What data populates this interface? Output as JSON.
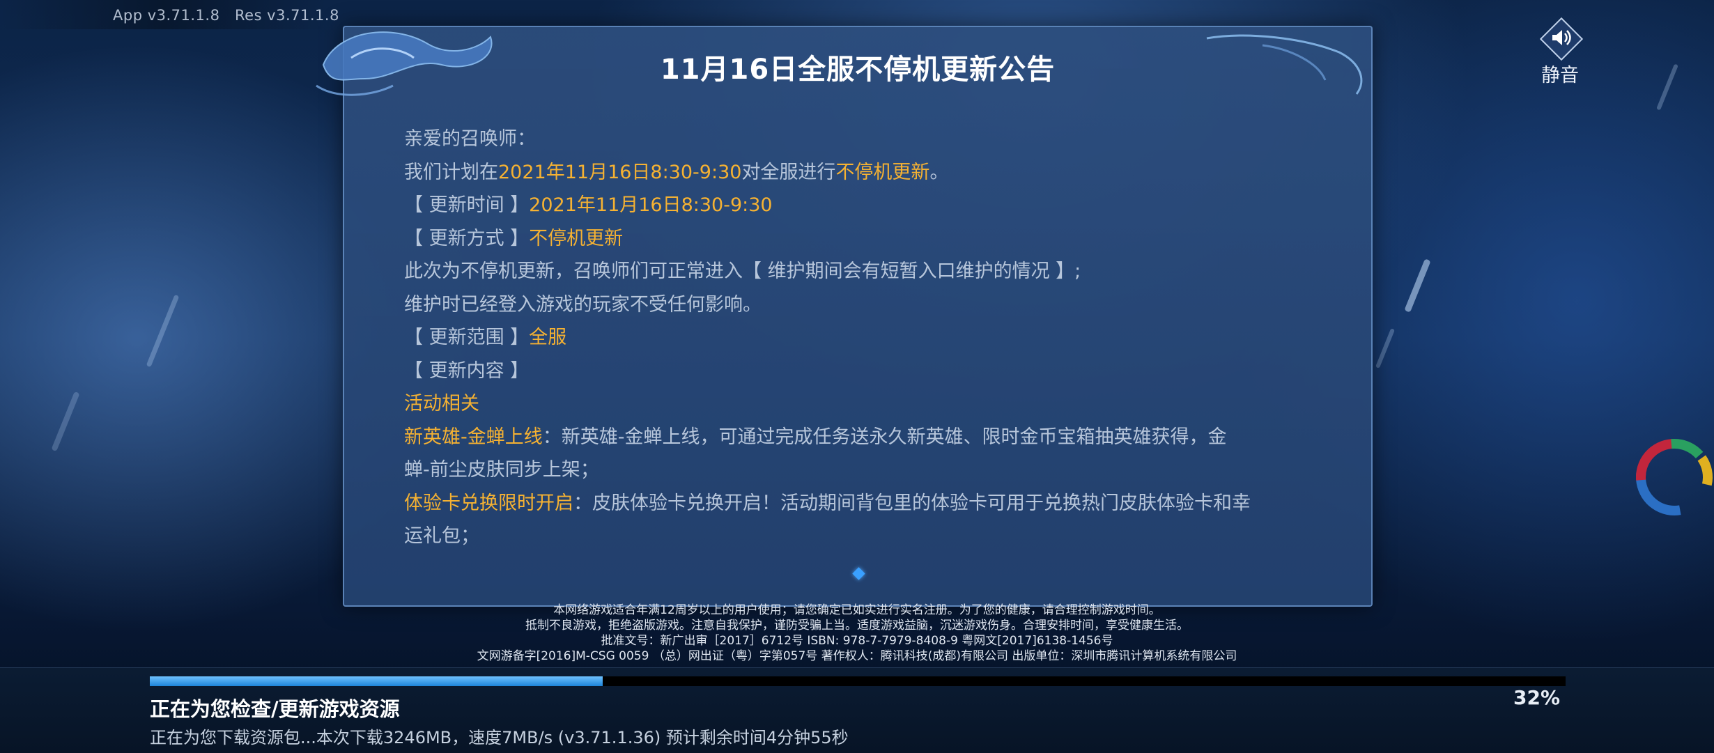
{
  "version_info": {
    "app": "App v3.71.1.8",
    "res": "Res v3.71.1.8"
  },
  "mute_button": {
    "label": "静音",
    "icon": "speaker-icon"
  },
  "notice": {
    "title": "11月16日全服不停机更新公告",
    "greeting": "亲爱的召唤师：",
    "line2": {
      "pre": "我们计划在",
      "time": "2021年11月16日8:30-9:30",
      "mid": "对全服进行",
      "mode": "不停机更新",
      "end": "。"
    },
    "time_label": "【 更新时间 】",
    "time_value": "2021年11月16日8:30-9:30",
    "mode_label": "【 更新方式 】",
    "mode_value": "不停机更新",
    "line5": "此次为不停机更新，召唤师们可正常进入【 维护期间会有短暂入口维护的情况 】;",
    "line6": "维护时已经登入游戏的玩家不受任何影响。",
    "scope_label": "【 更新范围 】",
    "scope_value": "全服",
    "content_label": "【 更新内容 】",
    "section": "活动相关",
    "item1_title": "新英雄-金蝉上线",
    "item1_text": "：新英雄-金蝉上线，可通过完成任务送永久新英雄、限时金币宝箱抽英雄获得，金",
    "item1_text2": "蝉-前尘皮肤同步上架；",
    "item2_title": "体验卡兑换限时开启",
    "item2_text": "：皮肤体验卡兑换开启！活动期间背包里的体验卡可用于兑换热门皮肤体验卡和幸",
    "item2_text2": "运礼包；"
  },
  "legal": [
    "本网络游戏适合年满12周岁以上的用户使用；请您确定已如实进行实名注册。为了您的健康，请合理控制游戏时间。",
    "抵制不良游戏，拒绝盗版游戏。注意自我保护，谨防受骗上当。适度游戏益脑，沉迷游戏伤身。合理安排时间，享受健康生活。",
    "批准文号：新广出审［2017］6712号 ISBN: 978-7-7979-8408-9 粤网文[2017]6138-1456号",
    "文网游备字[2016]M-CSG 0059 （总）网出证（粤）字第057号 著作权人：腾讯科技(成都)有限公司 出版单位：深圳市腾讯计算机系统有限公司"
  ],
  "download": {
    "progress": 0.32,
    "percent_text": "32%",
    "title": "正在为您检查/更新游戏资源",
    "detail": "正在为您下载资源包...本次下载3246MB，速度7MB/s (v3.71.1.36)  预计剩余时间4分钟55秒"
  },
  "colors": {
    "highlight": "#f6b232",
    "body_text": "#b7c6db",
    "progress": "#2a93e8"
  }
}
